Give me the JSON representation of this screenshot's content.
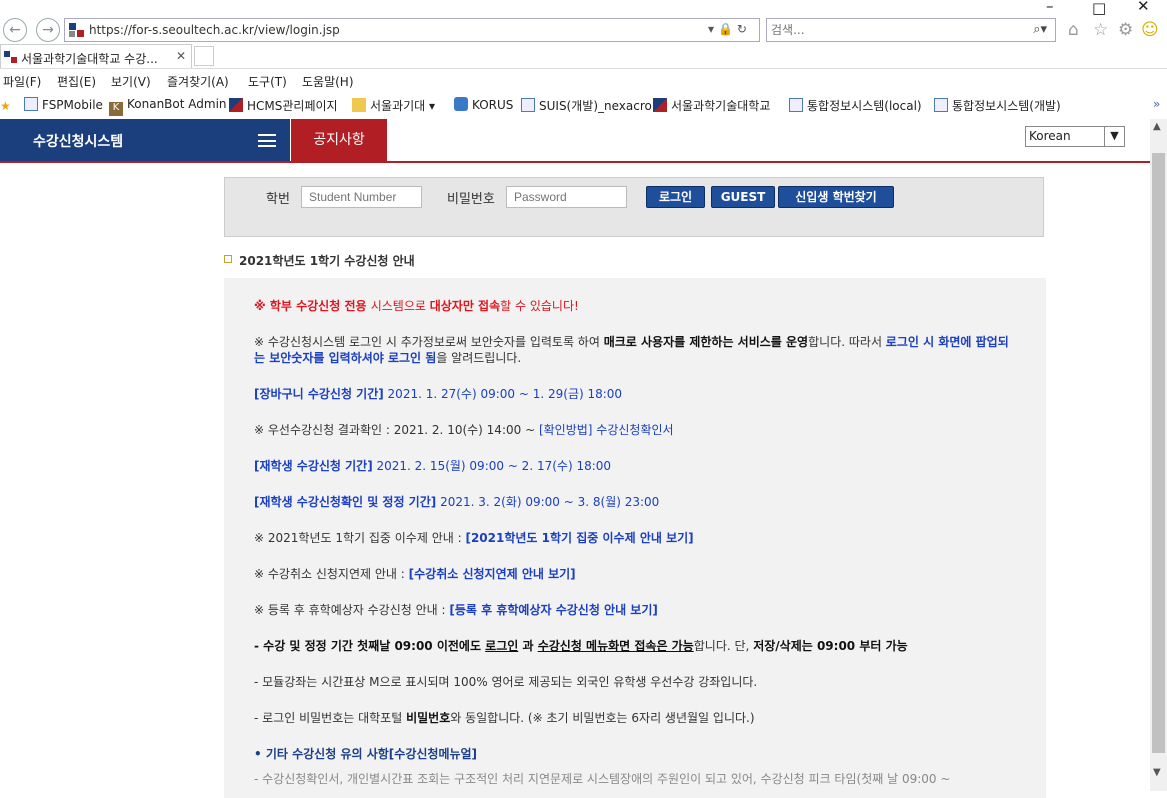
{
  "browser": {
    "url": "https://for-s.seoultech.ac.kr/view/login.jsp",
    "search_placeholder": "검색...",
    "tab_title": "서울과학기술대학교 수강...",
    "menu": [
      "파일(F)",
      "편집(E)",
      "보기(V)",
      "즐겨찾기(A)",
      "도구(T)",
      "도움말(H)"
    ],
    "favorites": [
      "FSPMobile",
      "KonanBot Admin",
      "HCMS관리페이지",
      "서울과기대",
      "KORUS",
      "SUIS(개발)_nexacro",
      "서울과학기술대학교",
      "통합정보시스템(local)",
      "통합정보시스템(개발)"
    ]
  },
  "header": {
    "brand": "수강신청시스템",
    "notice_tab": "공지사항",
    "language": "Korean"
  },
  "login": {
    "id_label": "학번",
    "id_placeholder": "Student Number",
    "pw_label": "비밀번호",
    "pw_placeholder": "Password",
    "login_button": "로그인",
    "guest_button": "GUEST",
    "find_button": "신입생 학번찾기"
  },
  "notice": {
    "title": "2021학년도 1학기 수강신청 안내",
    "l1a": "※ 학부 수강신청 전용 ",
    "l1b": "시스템으로 ",
    "l1c": "대상자만 접속",
    "l1d": "할 수 있습니다!",
    "l2a": "※ 수강신청시스템 로그인 시 추가정보로써 보안숫자를 입력토록 하여 ",
    "l2b": "매크로 사용자를 제한하는 서비스를 운영",
    "l2c": "합니다. 따라서 ",
    "l2d": "로그인 시 화면에 팝업되는 보안숫자를 입력하셔야 로그인 됨",
    "l2e": "을 알려드립니다.",
    "l3a": "[장바구니 수강신청 기간]",
    "l3b": " 2021. 1. 27(수) 09:00 ~ 1. 29(금) 18:00",
    "l4a": "※ 우선수강신청 결과확인 : 2021. 2. 10(수) 14:00 ~ ",
    "l4b": "[확인방법] 수강신청확인서",
    "l5a": "[재학생 수강신청 기간]",
    "l5b": " 2021. 2. 15(월) 09:00 ~ 2. 17(수) 18:00",
    "l6a": "[재학생 수강신청확인 및 정정 기간]",
    "l6b": " 2021. 3. 2(화) 09:00 ~ 3. 8(월) 23:00",
    "l7a": "※ 2021학년도 1학기 집중 이수제 안내 : ",
    "l7b": "[2021학년도 1학기 집중 이수제 안내 보기]",
    "l8a": "※ 수강취소 신청지연제 안내 : ",
    "l8b": "[수강취소 신청지연제 안내 보기]",
    "l9a": "※ 등록 후 휴학예상자 수강신청 안내 : ",
    "l9b": "[등록 후 휴학예상자 수강신청 안내 보기]",
    "l10a": "- 수강 및 정정 기간 첫째날 09:00 이전에도 ",
    "l10b": "로그인",
    "l10c": " 과 ",
    "l10d": "수강신청 메뉴화면 접속은 가능",
    "l10e": "합니다. 단, ",
    "l10f": "저장/삭제는 09:00 부터 가능",
    "l11": "- 모듈강좌는 시간표상 M으로 표시되며 100% 영어로 제공되는 외국인 유학생 우선수강 강좌입니다.",
    "l12a": "- 로그인 비밀번호는 대학포털 ",
    "l12b": "비밀번호",
    "l12c": "와 동일합니다. (※ 초기 비밀번호는 6자리 생년월일 입니다.)",
    "l13a": "• 기타 수강신청 유의 사항",
    "l13b": "[수강신청메뉴얼]",
    "l14": "- 수강신청확인서, 개인별시간표 조회는 구조적인 처리 지연문제로 시스템장애의 주원인이 되고 있어, 수강신청 피크 타임(첫째 날 09:00 ~"
  }
}
